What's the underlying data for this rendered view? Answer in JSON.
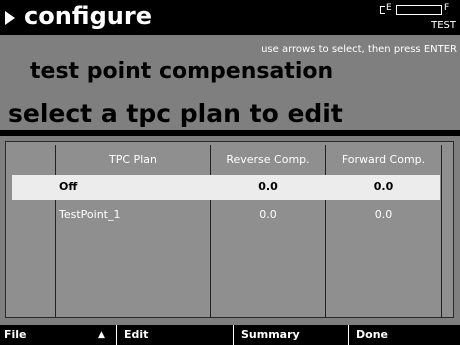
{
  "title_bar": {
    "title": "configure",
    "battery_empty_label": "E",
    "battery_full_label": "F",
    "mode_label": "TEST"
  },
  "instruction": "use arrows to select, then press ENTER",
  "screen_title": "test point compensation",
  "section_heading": "select a tpc plan to edit",
  "table": {
    "columns": [
      "TPC Plan",
      "Reverse Comp.",
      "Forward Comp."
    ],
    "rows": [
      {
        "plan": "Off",
        "reverse": "0.0",
        "forward": "0.0",
        "selected": true
      },
      {
        "plan": "TestPoint_1",
        "reverse": "0.0",
        "forward": "0.0",
        "selected": false
      }
    ]
  },
  "softkeys": {
    "file": "File",
    "arrow": "▲",
    "edit": "Edit",
    "summary": "Summary",
    "done": "Done"
  },
  "colors": {
    "title_bar": "#000000",
    "background": "#7f7f7f",
    "panel": "#8f8f8f",
    "selected_row": "#ececec",
    "text_light": "#ffffff"
  }
}
